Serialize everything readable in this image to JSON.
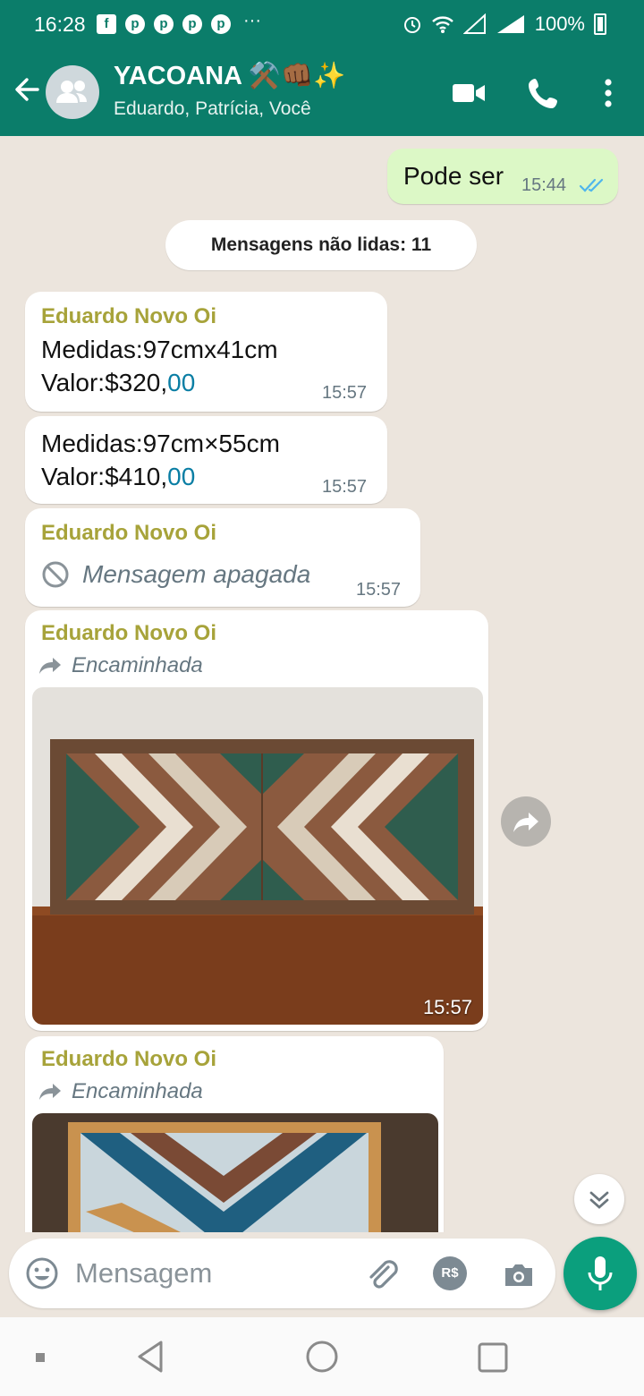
{
  "status_bar": {
    "time": "16:28",
    "more_indicator": "···",
    "battery": "100%",
    "notification_icons": [
      "facebook-icon",
      "pinterest-icon",
      "pinterest-icon",
      "pinterest-icon",
      "pinterest-icon"
    ]
  },
  "header": {
    "title": "YACOANA ⚒️👊🏾✨",
    "subtitle": "Eduardo, Patrícia, Você",
    "accent_color": "#0b7d6a"
  },
  "messages": {
    "outgoing_1": {
      "text": "Pode ser",
      "time": "15:44"
    },
    "unread_banner": "Mensagens não lidas: 11",
    "msg_1": {
      "sender": "Eduardo Novo Oi",
      "line1": "Medidas:97cmx41cm",
      "line2": "Valor:$320,",
      "cents": "00",
      "time": "15:57"
    },
    "msg_2": {
      "line1": "Medidas:97cm×55cm",
      "line2": "Valor:$410,",
      "cents": "00",
      "time": "15:57"
    },
    "msg_3": {
      "sender": "Eduardo Novo Oi",
      "text": "Mensagem apagada",
      "time": "15:57"
    },
    "msg_4": {
      "sender": "Eduardo Novo Oi",
      "forwarded": "Encaminhada",
      "time": "15:57"
    },
    "msg_5": {
      "sender": "Eduardo Novo Oi",
      "forwarded": "Encaminhada"
    }
  },
  "input": {
    "placeholder": "Mensagem",
    "payment_label": "R$"
  },
  "colors": {
    "sender_name": "#a7a33a",
    "outgoing_bubble": "#dcf8c6",
    "chat_background": "#ece5dd",
    "mic_button": "#0b9f7d"
  }
}
